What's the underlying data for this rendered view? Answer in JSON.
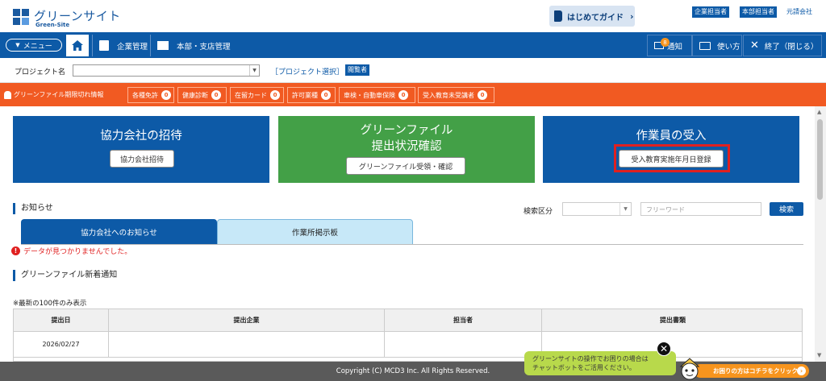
{
  "header": {
    "logo_jp": "グリーンサイト",
    "logo_en": "Green-Site",
    "guide_label": "はじめてガイド",
    "roles": [
      "企業担当者",
      "本部担当者"
    ],
    "company_label": "元請会社"
  },
  "nav": {
    "menu_label": "メニュー",
    "items": [
      "企業管理",
      "本部・支店管理"
    ],
    "notify_label": "通知",
    "notify_count": "8",
    "usage_label": "使い方",
    "exit_label": "終了（閉じる）"
  },
  "project": {
    "label": "プロジェクト名",
    "select_value": "",
    "select_link": "［プロジェクト選択］",
    "viewer_badge": "閲覧者"
  },
  "alert": {
    "title": "グリーンファイル期限切れ情報",
    "items": [
      {
        "label": "各種免許",
        "count": "0"
      },
      {
        "label": "健康診断",
        "count": "0"
      },
      {
        "label": "在留カード",
        "count": "0"
      },
      {
        "label": "許可業種",
        "count": "0"
      },
      {
        "label": "車検・自動車保険",
        "count": "0"
      },
      {
        "label": "受入教育未受講者",
        "count": "0"
      }
    ]
  },
  "cards": {
    "invite": {
      "title": "協力会社の招待",
      "button": "協力会社招待",
      "color": "#0d5aa7"
    },
    "greenfile": {
      "title_line1": "グリーンファイル",
      "title_line2": "提出状況確認",
      "button": "グリーンファイル受領・確認",
      "color": "#43a047"
    },
    "workers": {
      "title": "作業員の受入",
      "button": "受入教育実施年月日登録",
      "color": "#0d5aa7"
    }
  },
  "notices": {
    "heading": "お知らせ",
    "search_label": "検索区分",
    "search_select_value": "",
    "search_placeholder": "フリーワード",
    "search_button": "検索",
    "tabs": [
      "協力会社へのお知らせ",
      "作業所掲示板"
    ],
    "empty_message": "データが見つかりませんでした。"
  },
  "greenfile_new": {
    "heading": "グリーンファイル新着通知",
    "note": "※最新の100件のみ表示",
    "columns": [
      "提出日",
      "提出企業",
      "担当者",
      "提出書類"
    ],
    "rows": [
      [
        "2026/02/27",
        "",
        "",
        ""
      ]
    ]
  },
  "footer": {
    "copyright": "Copyright (C) MCD3 Inc. All Rights Reserved.",
    "chat_line1": "グリーンサイトの操作でお困りの場合は",
    "chat_line2": "チャットボットをご活用ください。",
    "chat_button": "お困りの方はコチラをクリック"
  }
}
